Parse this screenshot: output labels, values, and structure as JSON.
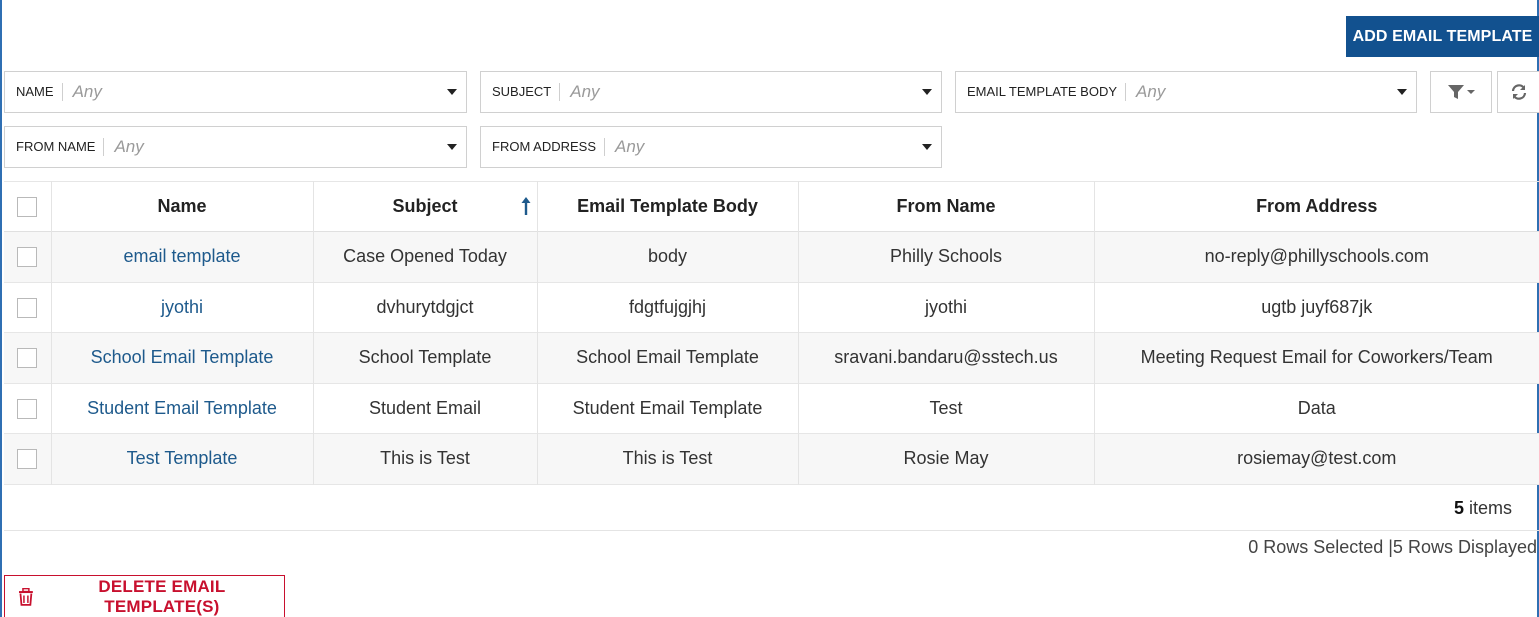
{
  "toolbar": {
    "add_label": "ADD EMAIL TEMPLATE"
  },
  "filters": [
    {
      "label": "NAME",
      "value": "Any"
    },
    {
      "label": "SUBJECT",
      "value": "Any"
    },
    {
      "label": "EMAIL TEMPLATE BODY",
      "value": "Any"
    },
    {
      "label": "FROM NAME",
      "value": "Any"
    },
    {
      "label": "FROM ADDRESS",
      "value": "Any"
    }
  ],
  "icons": {
    "filter": "filter-icon",
    "refresh": "refresh-icon",
    "sort": "sort-ascending-icon",
    "delete": "trash-icon"
  },
  "table": {
    "columns": [
      "Name",
      "Subject",
      "Email Template Body",
      "From Name",
      "From Address"
    ],
    "sort_column": "Subject",
    "rows": [
      [
        "email template",
        "Case Opened Today",
        "body",
        "Philly Schools",
        "no-reply@phillyschools.com"
      ],
      [
        "jyothi",
        "dvhurytdgjct",
        "fdgtfujgjhj",
        "jyothi",
        "ugtb juyf687jk"
      ],
      [
        "School Email Template",
        "School Template",
        "School Email Template",
        "sravani.bandaru@sstech.us",
        "Meeting Request Email for Coworkers/Team"
      ],
      [
        "Student Email Template",
        "Student Email",
        "Student Email Template",
        "Test",
        "Data"
      ],
      [
        "Test Template",
        "This is Test",
        "This is Test",
        "Rosie May",
        "rosiemay@test.com"
      ]
    ]
  },
  "footer": {
    "item_count": "5",
    "items_label": "items",
    "status": "0 Rows Selected |5 Rows Displayed"
  },
  "actions": {
    "delete_label": "DELETE EMAIL TEMPLATE(S)"
  },
  "colors": {
    "primary": "#12518f",
    "link": "#1e5a8c",
    "danger": "#c8102e",
    "frame": "#2f6fb3"
  }
}
